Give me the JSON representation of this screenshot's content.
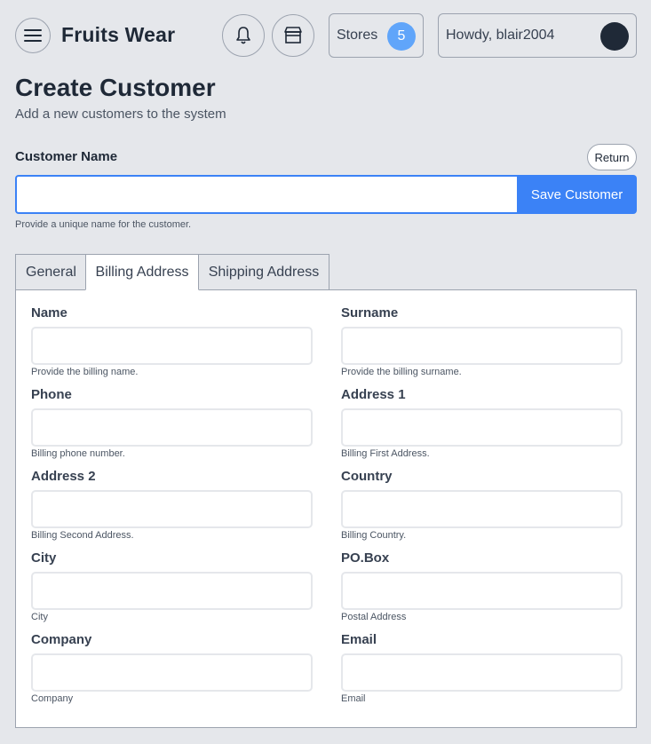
{
  "header": {
    "brand": "Fruits Wear",
    "stores_label": "Stores",
    "stores_count": "5",
    "user_greeting": "Howdy, blair2004"
  },
  "page": {
    "title": "Create Customer",
    "subtitle": "Add a new customers to the system"
  },
  "customer_name": {
    "label": "Customer Name",
    "value": "",
    "placeholder": "",
    "help": "Provide a unique name for the customer.",
    "save_label": "Save Customer",
    "return_label": "Return"
  },
  "tabs": [
    {
      "label": "General",
      "active": false
    },
    {
      "label": "Billing Address",
      "active": true
    },
    {
      "label": "Shipping Address",
      "active": false
    }
  ],
  "billing": {
    "fields": [
      {
        "label": "Name",
        "value": "",
        "help": "Provide the billing name."
      },
      {
        "label": "Surname",
        "value": "",
        "help": "Provide the billing surname."
      },
      {
        "label": "Phone",
        "value": "",
        "help": "Billing phone number."
      },
      {
        "label": "Address 1",
        "value": "",
        "help": "Billing First Address."
      },
      {
        "label": "Address 2",
        "value": "",
        "help": "Billing Second Address."
      },
      {
        "label": "Country",
        "value": "",
        "help": "Billing Country."
      },
      {
        "label": "City",
        "value": "",
        "help": "City"
      },
      {
        "label": "PO.Box",
        "value": "",
        "help": "Postal Address"
      },
      {
        "label": "Company",
        "value": "",
        "help": "Company"
      },
      {
        "label": "Email",
        "value": "",
        "help": "Email"
      }
    ]
  },
  "icons": {
    "menu": "menu-icon",
    "notifications": "bell-icon",
    "store": "store-icon"
  },
  "colors": {
    "accent": "#3b82f6",
    "badge": "#60a5fa",
    "background": "#e5e7eb",
    "avatar": "#1f2937"
  }
}
